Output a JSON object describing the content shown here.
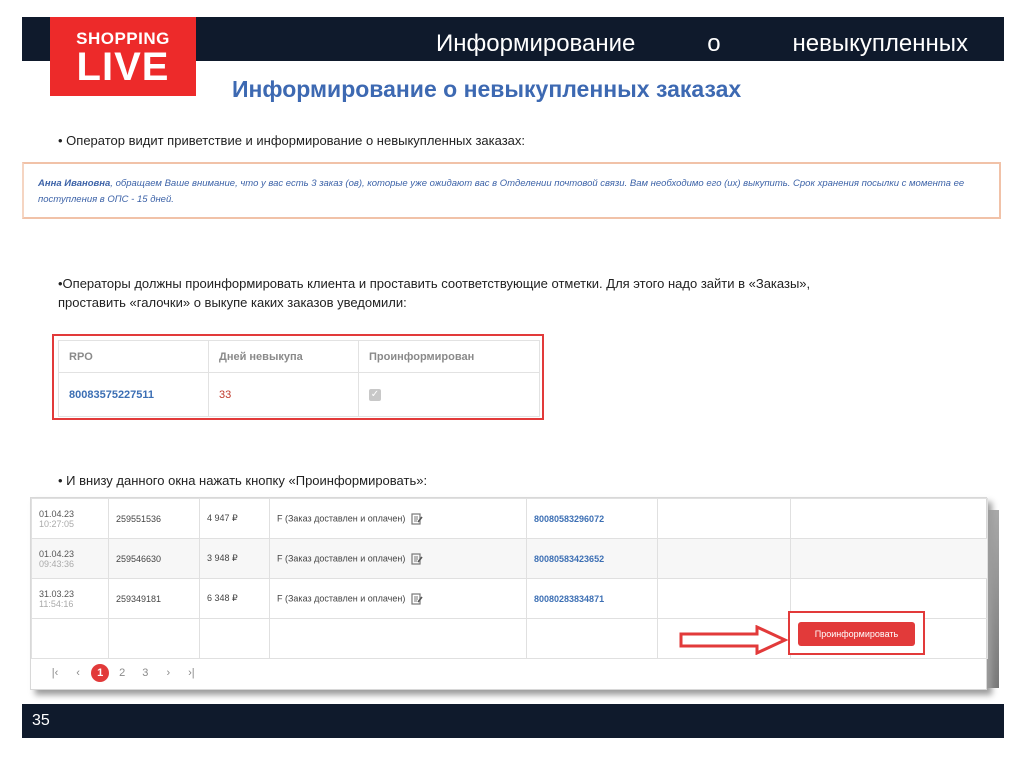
{
  "header": {
    "title": "Информирование о невыкупленных",
    "logo_line1": "SHOPPING",
    "logo_line2": "LIVE"
  },
  "subtitle": "Информирование о невыкупленных заказах",
  "bullets": {
    "b1": "• Оператор видит приветствие и информирование о невыкупленных заказах:",
    "b2_line1": "•Операторы должны проинформировать клиента и проставить соответствующие отметки. Для этого надо зайти в «Заказы»,",
    "b2_line2": "проставить «галочки» о выкупе каких заказов уведомили:",
    "b3": "• И внизу данного окна нажать кнопку «Проинформировать»:"
  },
  "message": {
    "name": "Анна Ивановна",
    "text": ", обращаем Ваше внимание, что у вас есть 3 заказ (ов), которые уже ожидают вас в Отделении почтовой связи. Вам необходимо его (их) выкупить. Срок хранения посылки с момента ее поступления в ОПС - 15 дней."
  },
  "rpo_table": {
    "headers": [
      "RPO",
      "Дней невыкупа",
      "Проинформирован"
    ],
    "row": {
      "rpo": "80083575227511",
      "days": "33",
      "check": "✓"
    }
  },
  "orders": {
    "rows": [
      {
        "date": "01.04.23",
        "time": "10:27:05",
        "id": "259551536",
        "sum": "4 947 ₽",
        "status": "F (Заказ доставлен и оплачен)",
        "track": "80080583296072"
      },
      {
        "date": "01.04.23",
        "time": "09:43:36",
        "id": "259546630",
        "sum": "3 948 ₽",
        "status": "F (Заказ доставлен и оплачен)",
        "track": "80080583423652"
      },
      {
        "date": "31.03.23",
        "time": "11:54:16",
        "id": "259349181",
        "sum": "6 348 ₽",
        "status": "F (Заказ доставлен и оплачен)",
        "track": "80080283834871"
      }
    ],
    "pager": {
      "first": "|‹",
      "prev": "‹",
      "p1": "1",
      "p2": "2",
      "p3": "3",
      "next": "›",
      "last": "›|"
    },
    "inform_button": "Проинформировать"
  },
  "footer": {
    "page_number": "35"
  },
  "colors": {
    "navy": "#0f1a2c",
    "red": "#e23a3a",
    "blue": "#3d69b2"
  }
}
